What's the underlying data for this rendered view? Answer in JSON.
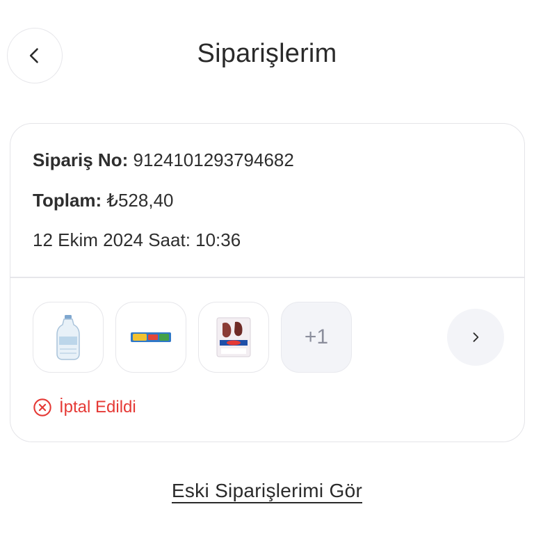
{
  "header": {
    "title": "Siparişlerim",
    "back_icon": "chevron-left-icon"
  },
  "order": {
    "number_label": "Sipariş No:",
    "number_value": "9124101293794682",
    "total_label": "Toplam:",
    "total_value": "₺528,40",
    "date_text": "12 Ekim 2024 Saat: 10:36",
    "products": [
      {
        "icon": "water-bottle-icon"
      },
      {
        "icon": "snack-bar-icon"
      },
      {
        "icon": "meat-pack-icon"
      }
    ],
    "more_count": "+1",
    "next_icon": "chevron-right-icon",
    "status_text": "İptal Edildi",
    "status_color": "#e53935"
  },
  "footer": {
    "old_orders_link": "Eski Siparişlerimi Gör"
  }
}
